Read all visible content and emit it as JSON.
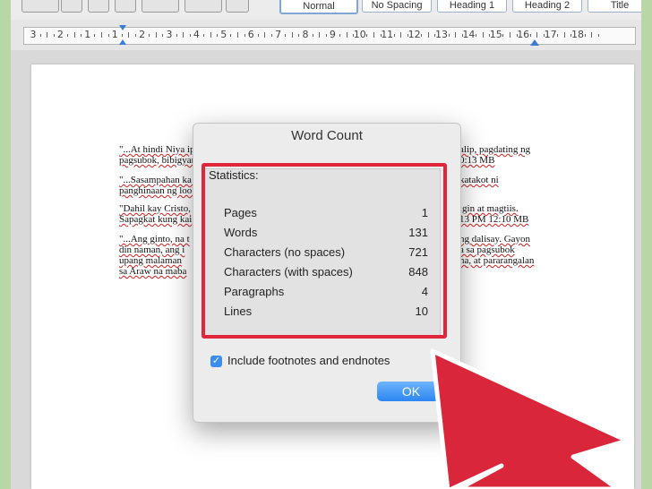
{
  "toolbar": {
    "styles": [
      {
        "label": "Normal"
      },
      {
        "label": "No Spacing"
      },
      {
        "label": "Heading 1"
      },
      {
        "label": "Heading 2"
      },
      {
        "label": "Title"
      }
    ]
  },
  "ruler": {
    "labels": [
      "3",
      "2",
      "1",
      "1",
      "2",
      "3",
      "4",
      "5",
      "6",
      "7",
      "8",
      "9",
      "10",
      "11",
      "12",
      "13",
      "14",
      "15",
      "16",
      "17",
      "18"
    ]
  },
  "document": {
    "lines": [
      {
        "left": "\"...At hindi Niya ip",
        "right": "alip, pagdating ng"
      },
      {
        "left": "pagsubok, bibigyan",
        "right": "0:13 MB"
      },
      {
        "left": "\"...Sasampahan ka n",
        "right": "katakot ni"
      },
      {
        "left": "panghinaan ng loob",
        "right": ""
      },
      {
        "left": "\"Dahil kay Cristo, ",
        "right": "igin at magtiis."
      },
      {
        "left": "Sapagkat kung kai",
        "right": "13 PM 12:10 MB"
      },
      {
        "left": "\"...Ang ginto, na t",
        "right": "ng dalisay. Gayon"
      },
      {
        "left": "din naman, ang i",
        "right": "a sa pagsubok"
      },
      {
        "left": "upang malaman",
        "right": "na, at pararangalan"
      },
      {
        "left": "sa Araw na maba",
        "right": ""
      }
    ]
  },
  "dialog": {
    "title": "Word Count",
    "statistics_label": "Statistics:",
    "stats": [
      {
        "label": "Pages",
        "value": "1"
      },
      {
        "label": "Words",
        "value": "131"
      },
      {
        "label": "Characters (no spaces)",
        "value": "721"
      },
      {
        "label": "Characters (with spaces)",
        "value": "848"
      },
      {
        "label": "Paragraphs",
        "value": "4"
      },
      {
        "label": "Lines",
        "value": "10"
      }
    ],
    "include_footnotes_label": "Include footnotes and endnotes",
    "include_footnotes_checked": true,
    "ok_label": "OK"
  },
  "colors": {
    "highlight": "#e0263a",
    "arrow": "#e0263a",
    "ok_button": "#2b86f2",
    "background": "#b9d6a6"
  },
  "annotation": {
    "icon": "red-pointer-arrow-icon"
  }
}
